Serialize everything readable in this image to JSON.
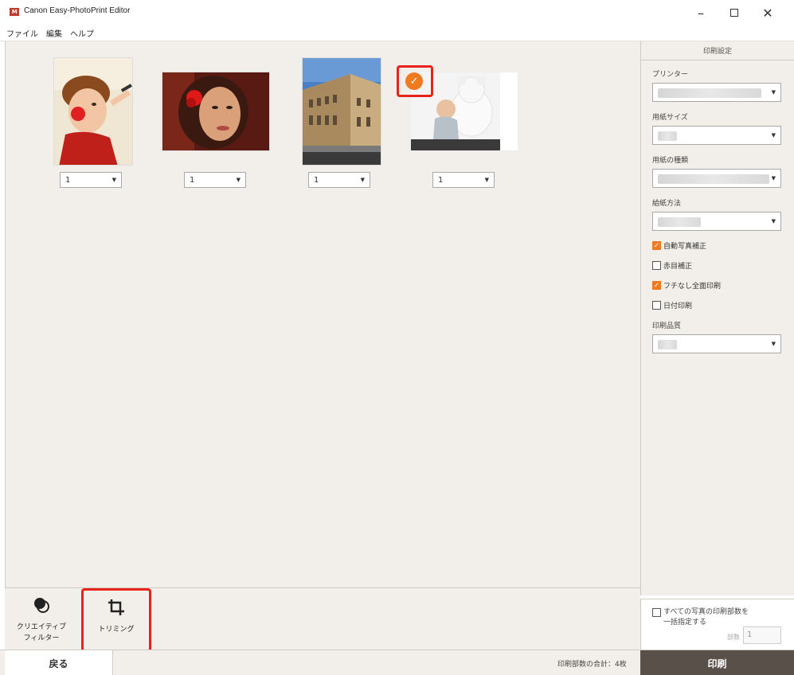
{
  "window": {
    "title": "Canon Easy-PhotoPrint Editor",
    "logo_text": "M",
    "minimize": "–",
    "close": "✕"
  },
  "menu": [
    "ファイル",
    "編集",
    "ヘルプ"
  ],
  "photos": [
    {
      "copies": "1",
      "selected": false
    },
    {
      "copies": "1",
      "selected": false
    },
    {
      "copies": "1",
      "selected": false
    },
    {
      "copies": "1",
      "selected": true
    }
  ],
  "select_arrow": "▼",
  "toolbar": {
    "creative_filter": "クリエイティブ\nフィルター",
    "trimming": "トリミング"
  },
  "bottom": {
    "back": "戻る",
    "total": "印刷部数の合計：4枚",
    "print": "印刷"
  },
  "settings": {
    "header": "印刷設定",
    "printer_label": "プリンター",
    "paper_size_label": "用紙サイズ",
    "paper_type_label": "用紙の種類",
    "feed_label": "給紙方法",
    "auto_correct": {
      "label": "自動写真補正",
      "checked": true
    },
    "redeye": {
      "label": "赤目補正",
      "checked": false
    },
    "borderless": {
      "label": "フチなし全面印刷",
      "checked": true
    },
    "date_print": {
      "label": "日付印刷",
      "checked": false
    },
    "quality_label": "印刷品質",
    "all_copies": {
      "label": "すべての写真の印刷部数を一括指定する",
      "checked": false
    },
    "copies_label": "部数",
    "copies_value": "1"
  },
  "colors": {
    "accent": "#f07a20",
    "highlight": "#e8241a",
    "print_button": "#5a504a"
  }
}
